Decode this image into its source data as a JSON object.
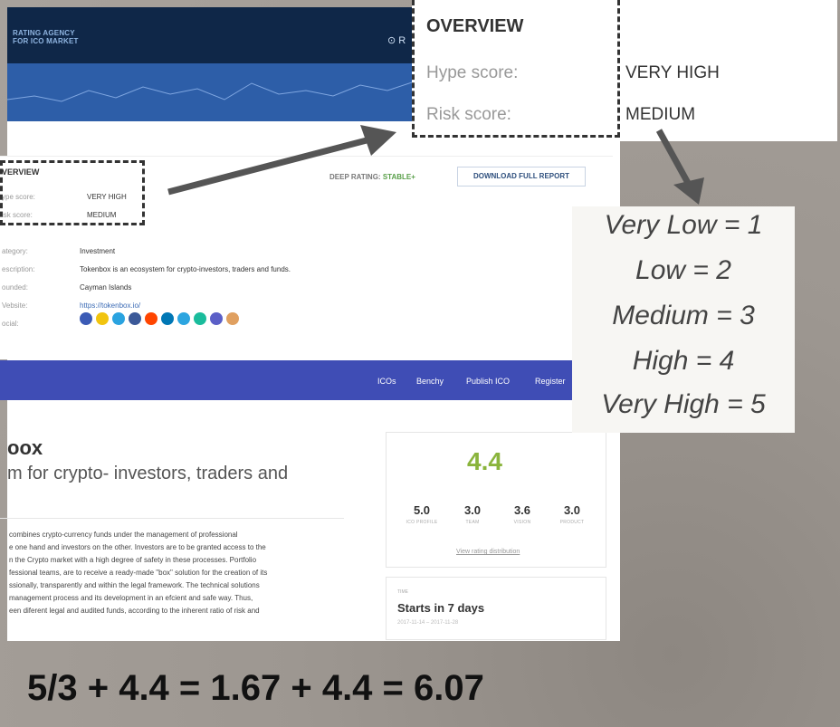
{
  "site": {
    "logo_line1": "RATING AGENCY",
    "logo_line2": "FOR ICO MARKET"
  },
  "overview_small": {
    "title": "VERVIEW",
    "rows": [
      {
        "label": "ype score:",
        "value": "VERY HIGH"
      },
      {
        "label": "isk score:",
        "value": "MEDIUM"
      },
      {
        "label": "ategory:",
        "value": "Investment"
      },
      {
        "label": "escription:",
        "value": "Tokenbox is an ecosystem for crypto-investors, traders and funds."
      },
      {
        "label": "ounded:",
        "value": "Cayman Islands"
      },
      {
        "label": "Vebsite:",
        "value": "https://tokenbox.io/"
      },
      {
        "label": "ocial:",
        "value": ""
      }
    ],
    "deep_rating_label": "DEEP RATING:",
    "deep_rating_value": "STABLE+",
    "download_button": "DOWNLOAD FULL REPORT",
    "social_colors": [
      "#3b5bb5",
      "#f1c40f",
      "#2aa3e0",
      "#3b5998",
      "#ff4500",
      "#0077b5",
      "#2ca5e0",
      "#1abc9c",
      "#5b5fc7",
      "#e0a060"
    ]
  },
  "nav": {
    "items": [
      "ICOs",
      "Benchy",
      "Publish ICO",
      "Register"
    ]
  },
  "project": {
    "name": "oox",
    "subtitle": "m for crypto- investors, traders and",
    "description_lines": [
      "combines crypto-currency funds under the management of professional",
      "e one hand and investors on the other. Investors are to be granted access to the",
      "n the Crypto market with a high degree of safety in these processes. Portfolio",
      "fessional teams, are to receive a ready-made \"box\" solution for the creation of its",
      "ssionally, transparently and within the legal framework. The technical solutions",
      "management process and its development in an efcient and safe way. Thus,",
      "een diferent legal and audited funds, according to the inherent ratio of risk and"
    ]
  },
  "rating": {
    "overall": "4.4",
    "scores": [
      {
        "value": "5.0",
        "label": "ICO PROFILE"
      },
      {
        "value": "3.0",
        "label": "TEAM"
      },
      {
        "value": "3.6",
        "label": "VISION"
      },
      {
        "value": "3.0",
        "label": "PRODUCT"
      }
    ],
    "link": "View rating distribution"
  },
  "time": {
    "label": "TIME",
    "main": "Starts in 7 days",
    "dates": "2017-11-14 – 2017-11-28"
  },
  "zoom": {
    "title": "OVERVIEW",
    "hype_label": "Hype score:",
    "hype_value": "VERY HIGH",
    "risk_label": "Risk score:",
    "risk_value": "MEDIUM"
  },
  "scale": [
    "Very Low = 1",
    "Low = 2",
    "Medium = 3",
    "High = 4",
    "Very High = 5"
  ],
  "formula": "5/3 + 4.4 = 1.67 + 4.4 = 6.07"
}
